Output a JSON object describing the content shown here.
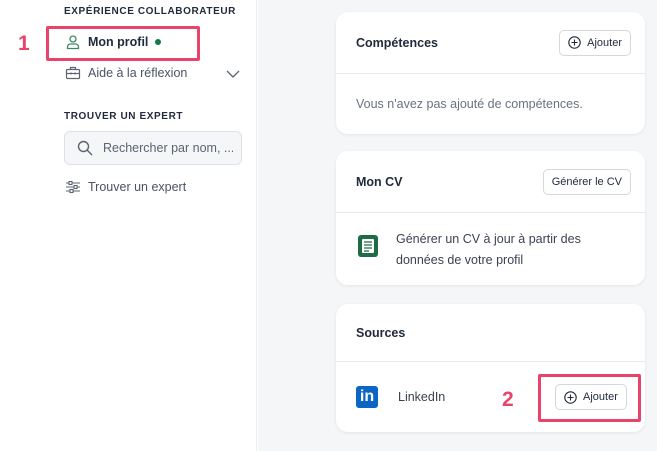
{
  "sidebar": {
    "section_experience": "EXPÉRIENCE COLLABORATEUR",
    "item_profile": "Mon profil",
    "item_reflection": "Aide à la réflexion",
    "section_expert": "TROUVER UN EXPERT",
    "search_placeholder": "Rechercher par nom, ...",
    "item_find_expert": "Trouver un expert"
  },
  "cards": {
    "skills": {
      "title": "Compétences",
      "add_label": "Ajouter",
      "empty_text": "Vous n'avez pas ajouté de compétences."
    },
    "cv": {
      "title": "Mon CV",
      "generate_label": "Générer le CV",
      "description_line1": "Générer un CV à jour à partir des",
      "description_line2": "données de votre profil"
    },
    "sources": {
      "title": "Sources",
      "linkedin_label": "LinkedIn",
      "linkedin_logo": "in",
      "add_label": "Ajouter"
    }
  },
  "annotations": {
    "marker_1": "1",
    "marker_2": "2",
    "color": "#e8436a"
  },
  "colors": {
    "status_dot": "#0f7a4a",
    "linkedin": "#0a66c2",
    "main_bg": "#f5f6f8"
  }
}
